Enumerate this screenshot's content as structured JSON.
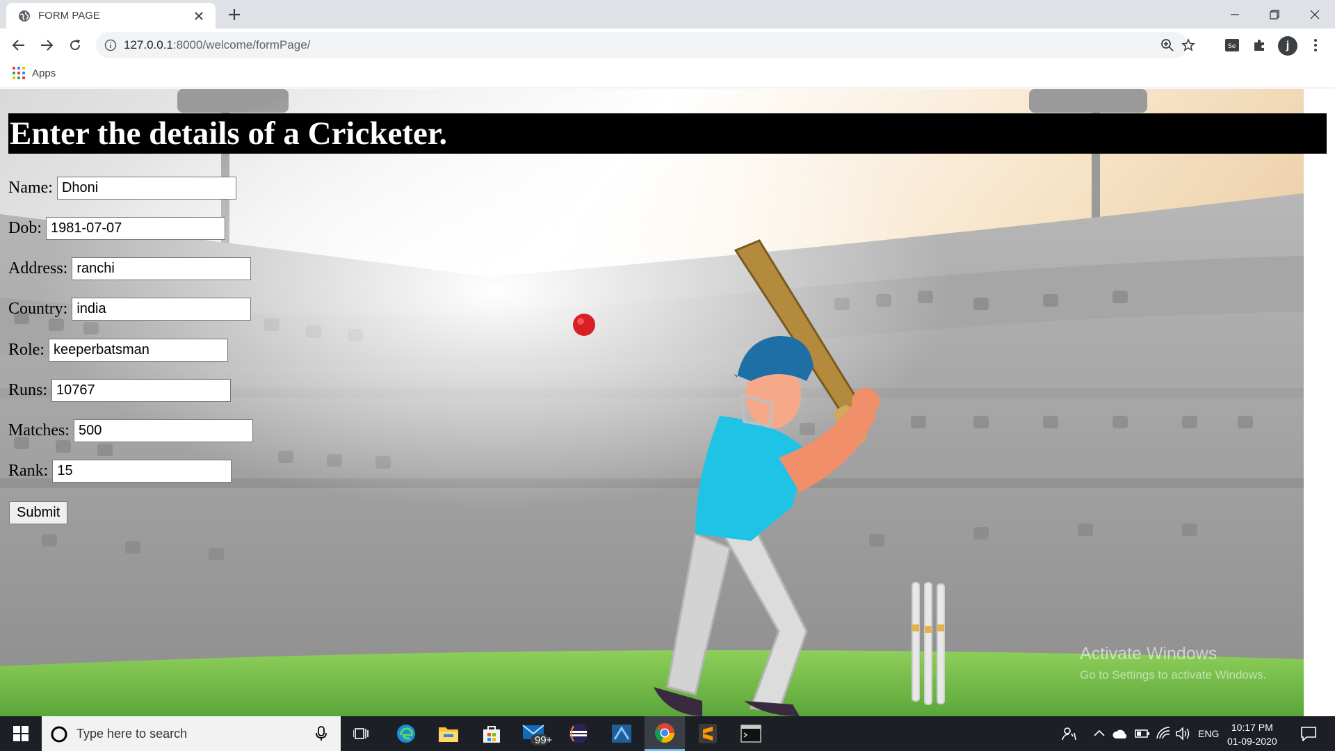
{
  "browser": {
    "tab_title": "FORM PAGE",
    "url_host": "127.0.0.1",
    "url_path": ":8000/welcome/formPage/",
    "bookmarks_apps_label": "Apps",
    "profile_initial": "j"
  },
  "page": {
    "heading": "Enter the details of a Cricketer.",
    "fields": [
      {
        "label": "Name:",
        "value": "Dhoni"
      },
      {
        "label": "Dob:",
        "value": "1981-07-07"
      },
      {
        "label": "Address:",
        "value": "ranchi"
      },
      {
        "label": "Country:",
        "value": "india"
      },
      {
        "label": "Role:",
        "value": "keeperbatsman"
      },
      {
        "label": "Runs:",
        "value": "10767"
      },
      {
        "label": "Matches:",
        "value": "500"
      },
      {
        "label": "Rank:",
        "value": "15"
      }
    ],
    "submit_label": "Submit",
    "watermark_title": "Activate Windows",
    "watermark_sub": "Go to Settings to activate Windows."
  },
  "taskbar": {
    "search_placeholder": "Type here to search",
    "mail_badge": "99+",
    "language": "ENG",
    "time": "10:17 PM",
    "date": "01-09-2020"
  },
  "colors": {
    "heading_bg": "#000000",
    "ball": "#d81f26",
    "shirt": "#1ec3e6",
    "helmet": "#1d6fa5",
    "grass": "#6fbf4a"
  },
  "icons": [
    "globe-icon",
    "close-icon",
    "plus-icon",
    "minimize-icon",
    "maximize-icon",
    "back-icon",
    "forward-icon",
    "reload-icon",
    "info-icon",
    "zoom-icon",
    "star-icon",
    "extension-icon",
    "puzzle-icon",
    "more-icon",
    "apps-grid-icon",
    "windows-start-icon",
    "cortana-icon",
    "mic-icon",
    "task-view-icon",
    "edge-icon",
    "file-explorer-icon",
    "store-icon",
    "mail-icon",
    "eclipse-icon",
    "app-icon",
    "chrome-icon",
    "sublime-icon",
    "terminal-icon",
    "people-icon",
    "tray-chevron-icon",
    "onedrive-icon",
    "battery-icon",
    "wifi-icon",
    "volume-icon",
    "notification-icon"
  ]
}
